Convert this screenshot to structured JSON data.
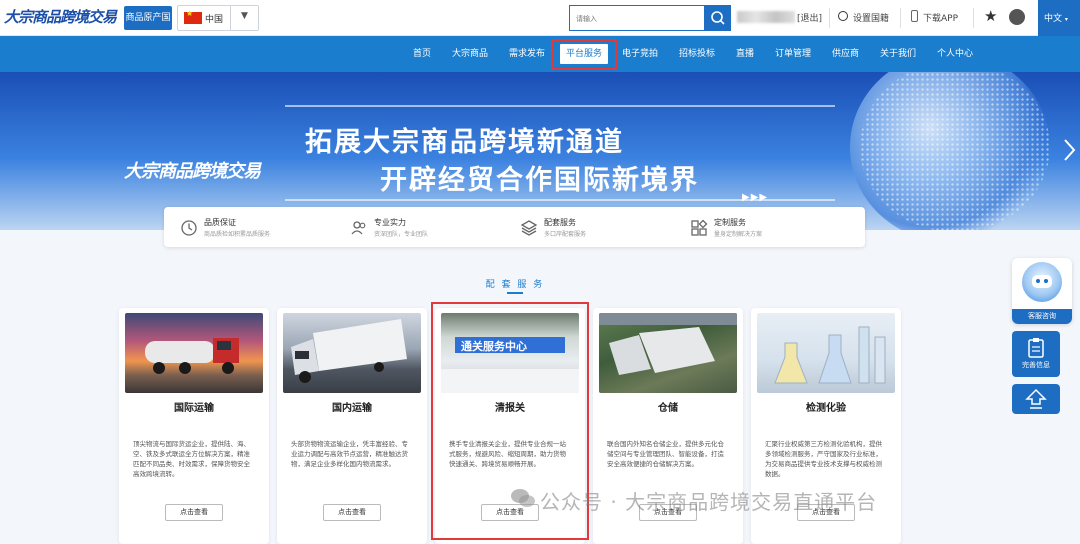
{
  "header": {
    "logo_text": "大宗商品跨境交易",
    "origin_label": "商品原产国",
    "country": "中国",
    "search_placeholder": "请输入",
    "logout": "[退出]",
    "language_settings": "设置国籍",
    "download_app": "下载APP",
    "language": "中文"
  },
  "nav": {
    "items": [
      {
        "label": "首页"
      },
      {
        "label": "大宗商品"
      },
      {
        "label": "需求发布"
      },
      {
        "label": "平台服务"
      },
      {
        "label": "电子竞拍"
      },
      {
        "label": "招标投标"
      },
      {
        "label": "直播"
      },
      {
        "label": "订单管理"
      },
      {
        "label": "供应商"
      },
      {
        "label": "关于我们"
      },
      {
        "label": "个人中心"
      }
    ],
    "active_index": 3
  },
  "banner": {
    "line1": "拓展大宗商品跨境新通道",
    "line2": "开辟经贸合作国际新境界",
    "logo_text": "大宗商品跨境交易"
  },
  "features": [
    {
      "title": "品质保证",
      "desc": "商品质检如积累品质服务",
      "icon": "clock-icon"
    },
    {
      "title": "专业实力",
      "desc": "资深团队，专业团队",
      "icon": "people-icon"
    },
    {
      "title": "配套服务",
      "desc": "多口岸配套服务",
      "icon": "layers-icon"
    },
    {
      "title": "定制服务",
      "desc": "量身定制解决方案",
      "icon": "grid-icon"
    }
  ],
  "section": {
    "title": "配 套 服 务"
  },
  "cards": [
    {
      "title": "国际运输",
      "desc": "顶尖物流与国际货运企业，提供陆、海、空、铁及多式联运全方位解决方案，精准匹配不同品类、时效需求，保障货物安全高效跨境流转。",
      "button": "点击查看"
    },
    {
      "title": "国内运输",
      "desc": "头部货物物流运输企业，凭丰富经验、专业运力调配与高效节点运营，精准触达货物，满足企业多样化国内物流需求。",
      "button": "点击查看"
    },
    {
      "title": "清报关",
      "desc": "携手专业清报关企业，提供专业合规一站式服务，规避风险、缩短周期，助力货物快速通关、跨境贸易顺畅开展。",
      "button": "点击查看",
      "image_sign": "通关服务中心"
    },
    {
      "title": "仓储",
      "desc": "联合国内外知名仓储企业，提供多元化仓储空间与专业管理团队、智能设备，打造安全高效便捷的仓储解决方案。",
      "button": "点击查看"
    },
    {
      "title": "检测化验",
      "desc": "汇聚行业权威第三方检测化验机构，提供多领域检测服务，严守国家及行业标准，为交易商品提供专业技术支撑与权威检测数据。",
      "button": "点击查看"
    }
  ],
  "floating": {
    "service_label": "客服咨询",
    "info_label": "完善信息"
  },
  "watermark": "公众号 · 大宗商品跨境交易直通平台",
  "colors": {
    "brand": "#1a7dcd",
    "highlight": "#e23a3a"
  }
}
